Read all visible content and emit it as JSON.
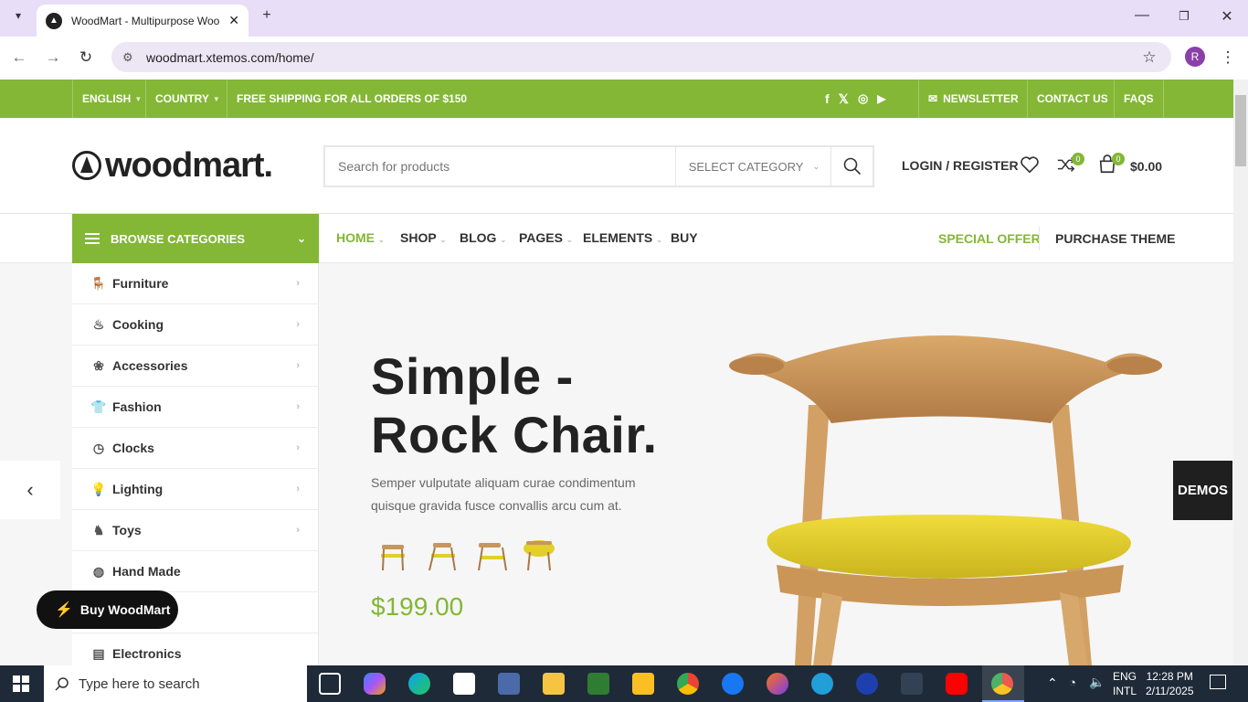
{
  "browser": {
    "tab_title": "WoodMart - Multipurpose Woo",
    "url": "woodmart.xtemos.com/home/",
    "profile_initial": "R"
  },
  "topbar": {
    "language": "ENGLISH",
    "country": "COUNTRY",
    "shipping": "FREE SHIPPING FOR ALL ORDERS OF $150",
    "newsletter": "NEWSLETTER",
    "contact": "CONTACT US",
    "faqs": "FAQS"
  },
  "header": {
    "logo": "woodmart.",
    "search_placeholder": "Search for products",
    "select_category": "SELECT CATEGORY",
    "login": "LOGIN / REGISTER",
    "compare_count": "0",
    "cart_count": "0",
    "cart_total": "$0.00"
  },
  "nav": {
    "browse": "BROWSE CATEGORIES",
    "links": [
      "HOME",
      "SHOP",
      "BLOG",
      "PAGES",
      "ELEMENTS",
      "BUY"
    ],
    "special": "SPECIAL OFFER",
    "purchase": "PURCHASE THEME"
  },
  "categories": [
    {
      "label": "Furniture",
      "icon": "chair-icon"
    },
    {
      "label": "Cooking",
      "icon": "cooking-icon"
    },
    {
      "label": "Accessories",
      "icon": "accessories-icon"
    },
    {
      "label": "Fashion",
      "icon": "shirt-icon"
    },
    {
      "label": "Clocks",
      "icon": "clock-icon"
    },
    {
      "label": "Lighting",
      "icon": "bulb-icon"
    },
    {
      "label": "Toys",
      "icon": "rocking-horse-icon"
    },
    {
      "label": "Hand Made",
      "icon": "yarn-icon"
    },
    {
      "label": "",
      "icon": ""
    },
    {
      "label": "Electronics",
      "icon": "electronics-icon"
    }
  ],
  "hero": {
    "title_line1": "Simple -",
    "title_line2": "Rock Chair.",
    "description": "Semper vulputate aliquam curae condimentum quisque gravida fusce convallis arcu cum at.",
    "price": "$199.00"
  },
  "demos": "DEMOS",
  "buy_button": "Buy WoodMart",
  "taskbar": {
    "search_placeholder": "Type here to search",
    "lang1": "ENG",
    "lang2": "INTL",
    "time": "12:28 PM",
    "date": "2/11/2025"
  },
  "colors": {
    "accent": "#83b735",
    "chair_seat": "#e3cf2a",
    "chair_wood": "#c8955a"
  }
}
